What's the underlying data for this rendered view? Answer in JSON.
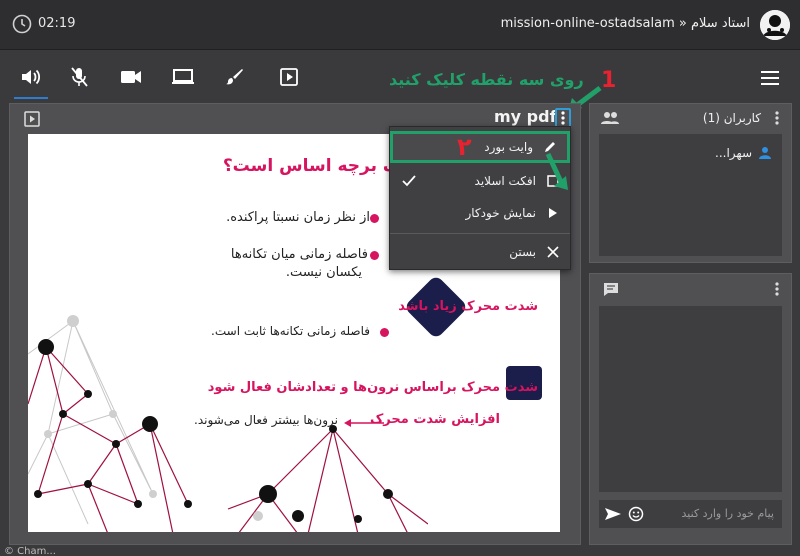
{
  "topbar": {
    "time": "02:19",
    "title": "mission-online-ostadsalam » استاد سلام"
  },
  "presentation": {
    "title": "my pdf"
  },
  "annotation": {
    "step1_number": "1",
    "step1_text": "روی سه نقطه کلیک کنید",
    "step2_number": "۲",
    "color": "#21a06a"
  },
  "menu": {
    "items": [
      {
        "label": "وایت بورد",
        "icon": "pencil-icon"
      },
      {
        "label": "افکت اسلاید",
        "icon": "check-icon"
      },
      {
        "label": "نمایش خودکار",
        "icon": "play-triangle-icon"
      },
      {
        "label": "بستن",
        "icon": "close-icon"
      }
    ]
  },
  "slide": {
    "title": "گذاری شدت محرک برچه اساس است؟",
    "bullet1": "از نظر زمان نسبتا پراکنده.",
    "bullet2_line1": "فاصله زمانی میان تکانه‌ها",
    "bullet2_line2": "یکسان نیست.",
    "heading2": "شدت محرک زیاد باشد",
    "bullet3": "فاصله زمانی تکانه‌ها ثابت است.",
    "heading3": "شدت محرک براساس نرون‌ها و تعدادشان فعال شود",
    "arrow_label": "افزایش شدت محرک",
    "arrow_text": "نرون‌ها بیشتر فعال می‌شوند.",
    "accent": "#d6145f",
    "navy": "#1b1d4a"
  },
  "users": {
    "title": "کاربران (1)",
    "user1": "سهرا..."
  },
  "chat": {
    "placeholder": "پیام خود را وارد کنید"
  },
  "footer": {
    "text": "© Cham..."
  },
  "colors": {
    "bg": "#3a3a3c",
    "panel": "#505053",
    "accent_blue": "#2f7bd0"
  }
}
